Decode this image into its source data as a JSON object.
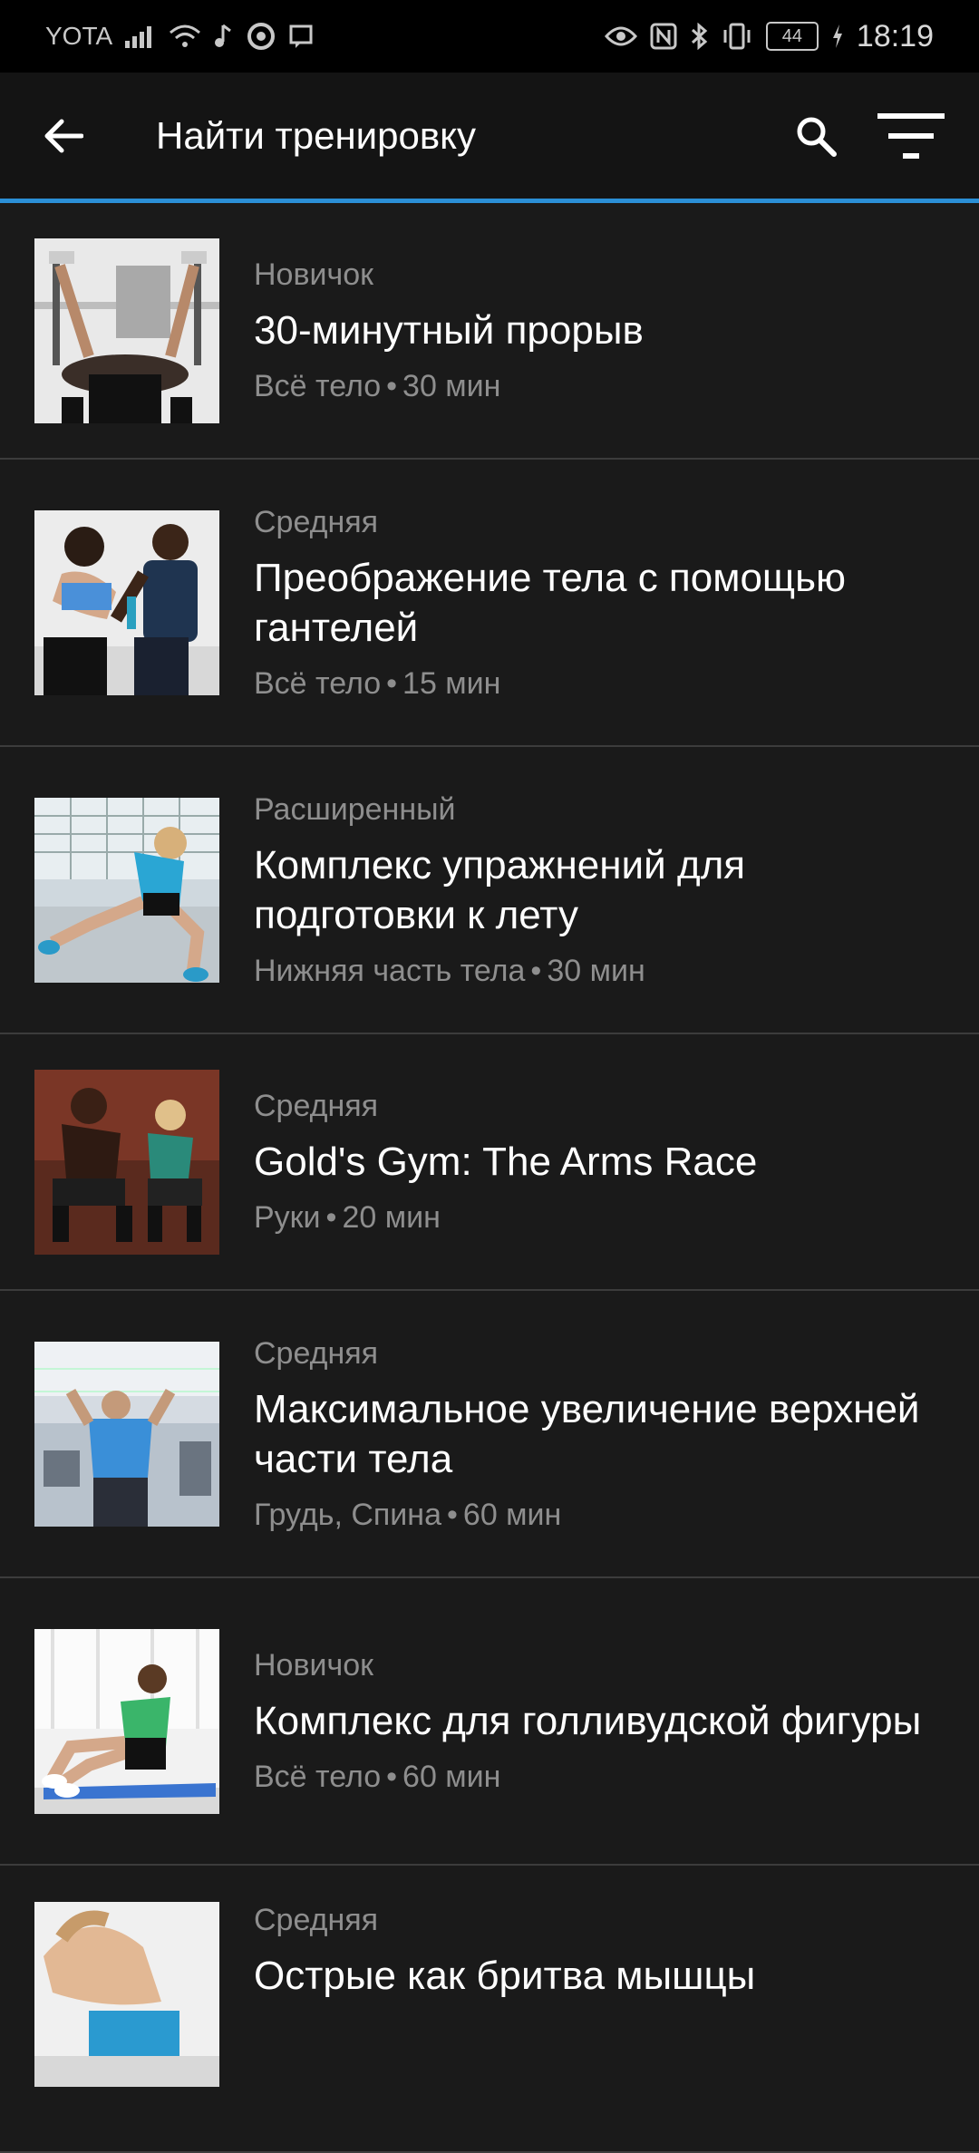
{
  "status_bar": {
    "carrier": "YOTA",
    "battery": "44",
    "time": "18:19",
    "icons_left": [
      "signal-icon",
      "wifi-icon",
      "music-note-icon",
      "beats-icon",
      "message-icon"
    ],
    "icons_right": [
      "eye-icon",
      "nfc-icon",
      "bluetooth-icon",
      "vibrate-icon",
      "battery-icon",
      "charging-icon"
    ]
  },
  "header": {
    "title": "Найти тренировку",
    "accent_color": "#2b8fd6"
  },
  "workouts": [
    {
      "level": "Новичок",
      "name": "30-минутный прорыв",
      "area": "Всё тело",
      "duration": "30 мин"
    },
    {
      "level": "Средняя",
      "name": "Преображение тела с помощью гантелей",
      "area": "Всё тело",
      "duration": "15 мин"
    },
    {
      "level": "Расширенный",
      "name": "Комплекс упражнений для подготовки к лету",
      "area": "Нижняя часть тела",
      "duration": "30 мин"
    },
    {
      "level": "Средняя",
      "name": "Gold's Gym: The Arms Race",
      "area": "Руки",
      "duration": "20 мин"
    },
    {
      "level": "Средняя",
      "name": "Максимальное увеличение верхней части тела",
      "area": "Грудь, Спина",
      "duration": "60 мин"
    },
    {
      "level": "Новичок",
      "name": "Комплекс для голливудской фигуры",
      "area": "Всё тело",
      "duration": "60 мин"
    },
    {
      "level": "Средняя",
      "name": "Острые как бритва мышцы",
      "area": "",
      "duration": ""
    }
  ]
}
